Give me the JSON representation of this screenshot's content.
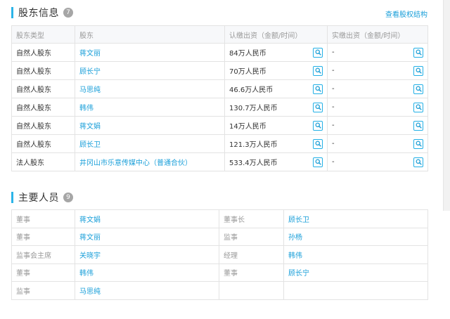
{
  "shareholders": {
    "title": "股东信息",
    "count": "7",
    "link_label": "查看股权结构",
    "columns": [
      "股东类型",
      "股东",
      "认缴出资（金额/时间）",
      "实缴出资（金额/时间）"
    ],
    "rows": [
      {
        "type": "自然人股东",
        "name": "蒋文丽",
        "subscribed": "84万人民币",
        "paid": "-"
      },
      {
        "type": "自然人股东",
        "name": "顾长宁",
        "subscribed": "70万人民币",
        "paid": "-"
      },
      {
        "type": "自然人股东",
        "name": "马思纯",
        "subscribed": "46.6万人民币",
        "paid": "-"
      },
      {
        "type": "自然人股东",
        "name": "韩伟",
        "subscribed": "130.7万人民币",
        "paid": "-"
      },
      {
        "type": "自然人股东",
        "name": "蒋文娟",
        "subscribed": "14万人民币",
        "paid": "-"
      },
      {
        "type": "自然人股东",
        "name": "顾长卫",
        "subscribed": "121.3万人民币",
        "paid": "-"
      },
      {
        "type": "法人股东",
        "name": "井冈山市乐意传媒中心（普通合伙）",
        "subscribed": "533.4万人民币",
        "paid": "-"
      }
    ],
    "search_icon": "magnifier-icon",
    "accent_color": "#2bb4e8",
    "link_color": "#1a9fd9"
  },
  "personnel": {
    "title": "主要人员",
    "count": "9",
    "rows": [
      [
        {
          "role": "董事",
          "name": "蒋文娟"
        },
        {
          "role": "董事长",
          "name": "顾长卫"
        }
      ],
      [
        {
          "role": "董事",
          "name": "蒋文丽"
        },
        {
          "role": "监事",
          "name": "孙杨"
        }
      ],
      [
        {
          "role": "监事会主席",
          "name": "关晓宇"
        },
        {
          "role": "经理",
          "name": "韩伟"
        }
      ],
      [
        {
          "role": "董事",
          "name": "韩伟"
        },
        {
          "role": "董事",
          "name": "顾长宁"
        }
      ],
      [
        {
          "role": "监事",
          "name": "马思纯"
        },
        {
          "role": "",
          "name": ""
        }
      ]
    ]
  }
}
